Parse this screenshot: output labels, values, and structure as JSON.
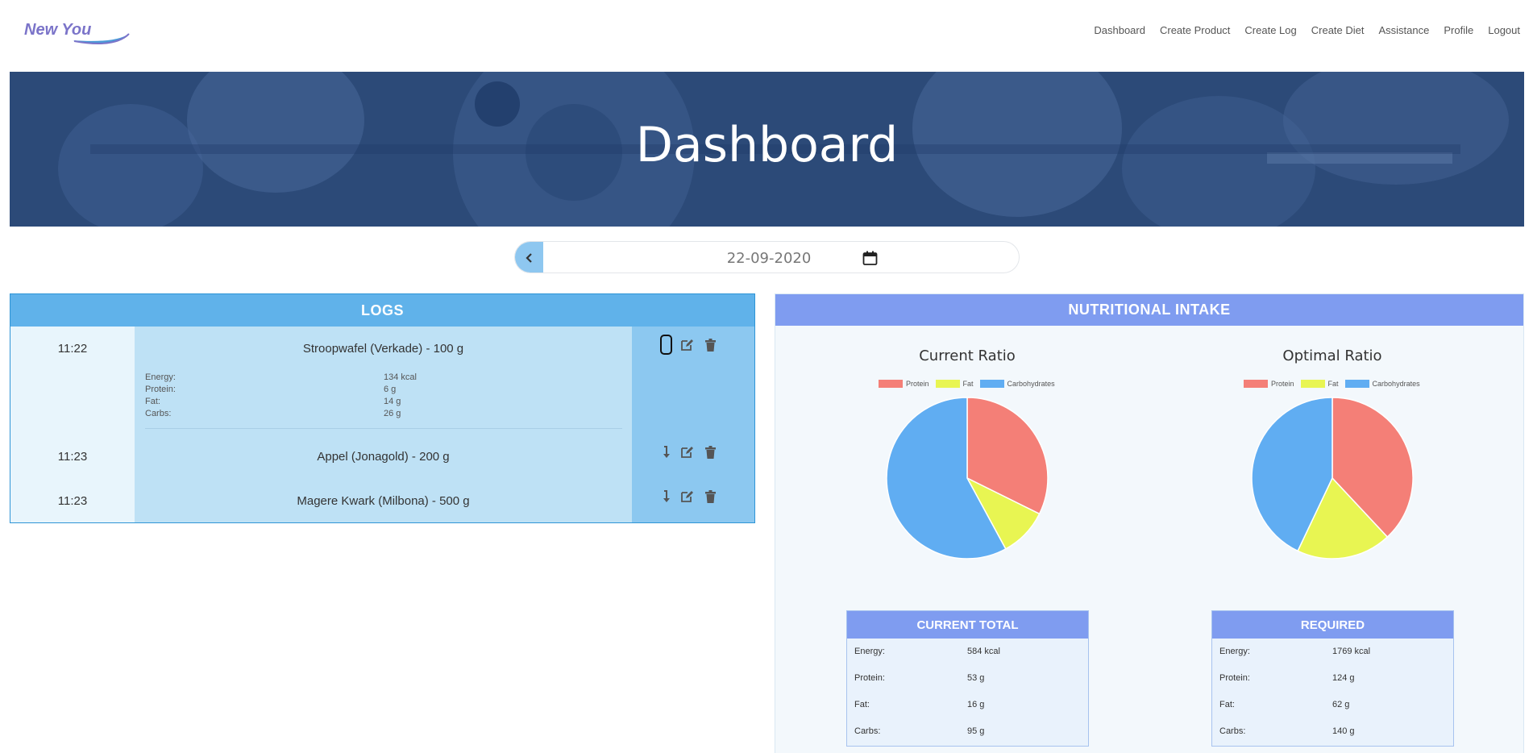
{
  "nav": {
    "logo_text": "New You",
    "links": [
      "Dashboard",
      "Create Product",
      "Create Log",
      "Create Diet",
      "Assistance",
      "Profile",
      "Logout"
    ]
  },
  "hero": {
    "title": "Dashboard"
  },
  "date_picker": {
    "value": "22-09-2020",
    "prev_icon": "chevron-left-icon",
    "calendar_icon": "calendar-icon"
  },
  "logs": {
    "header": "LOGS",
    "entries": [
      {
        "time": "11:22",
        "name": "Stroopwafel (Verkade) - 100 g",
        "expanded": true,
        "details": [
          {
            "label": "Energy:",
            "value": "134 kcal"
          },
          {
            "label": "Protein:",
            "value": "6 g"
          },
          {
            "label": "Fat:",
            "value": "14 g"
          },
          {
            "label": "Carbs:",
            "value": "26 g"
          }
        ]
      },
      {
        "time": "11:23",
        "name": "Appel (Jonagold) - 200 g",
        "expanded": false
      },
      {
        "time": "11:23",
        "name": "Magere Kwark (Milbona) - 500 g",
        "expanded": false
      }
    ]
  },
  "nutrition": {
    "header": "NUTRITIONAL INTAKE",
    "current_title": "Current Ratio",
    "optimal_title": "Optimal Ratio",
    "legend": [
      "Protein",
      "Fat",
      "Carbohydrates"
    ],
    "colors": {
      "protein": "#f47f77",
      "fat": "#e8f552",
      "carbs": "#60adf2"
    },
    "current_total": {
      "title": "CURRENT TOTAL",
      "rows": [
        {
          "label": "Energy:",
          "value": "584 kcal"
        },
        {
          "label": "Protein:",
          "value": "53 g"
        },
        {
          "label": "Fat:",
          "value": "16 g"
        },
        {
          "label": "Carbs:",
          "value": "95 g"
        }
      ]
    },
    "required": {
      "title": "REQUIRED",
      "rows": [
        {
          "label": "Energy:",
          "value": "1769 kcal"
        },
        {
          "label": "Protein:",
          "value": "124 g"
        },
        {
          "label": "Fat:",
          "value": "62 g"
        },
        {
          "label": "Carbs:",
          "value": "140 g"
        }
      ]
    }
  },
  "chart_data": [
    {
      "type": "pie",
      "title": "Current Ratio",
      "categories": [
        "Protein",
        "Fat",
        "Carbohydrates"
      ],
      "values": [
        53,
        16,
        95
      ]
    },
    {
      "type": "pie",
      "title": "Optimal Ratio",
      "categories": [
        "Protein",
        "Fat",
        "Carbohydrates"
      ],
      "values": [
        124,
        62,
        140
      ]
    }
  ]
}
